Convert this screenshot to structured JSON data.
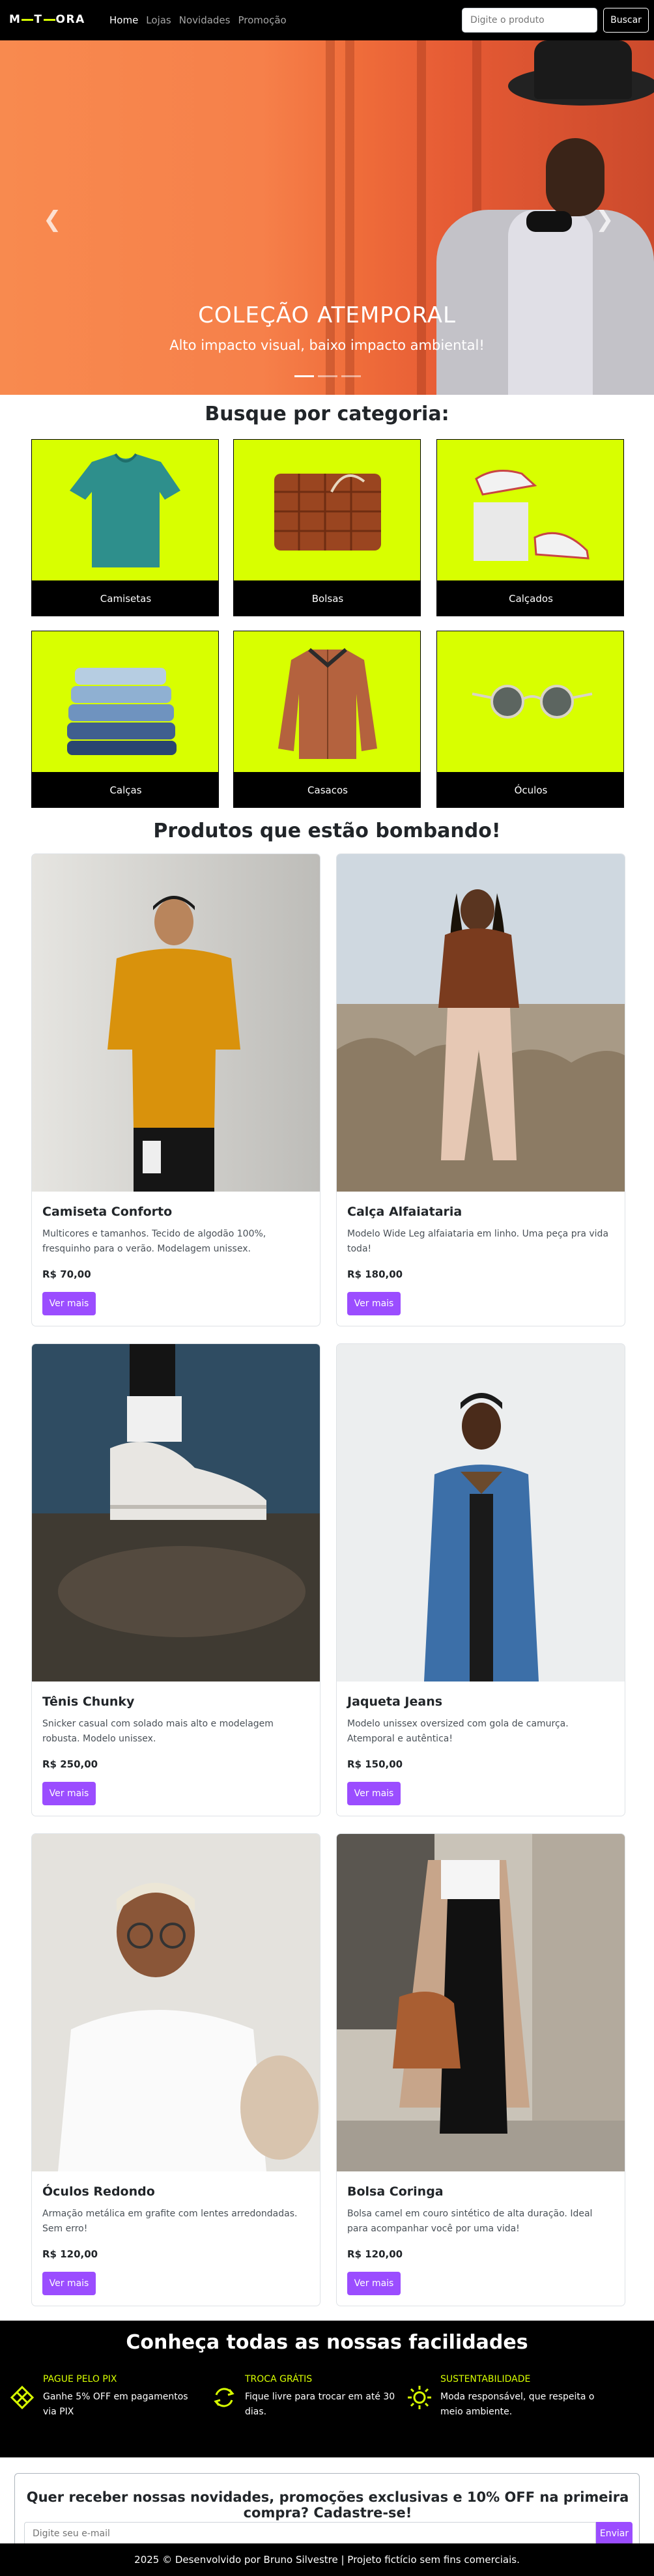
{
  "navbar": {
    "logo": "METEORA",
    "links": [
      "Home",
      "Lojas",
      "Novidades",
      "Promoção"
    ],
    "search_placeholder": "Digite o produto",
    "search_button": "Buscar"
  },
  "hero": {
    "title": "COLEÇÃO ATEMPORAL",
    "subtitle": "Alto impacto visual, baixo impacto ambiental!",
    "prev_icon": "chevron-left-icon",
    "next_icon": "chevron-right-icon",
    "slide_count": 3,
    "active_slide": 1
  },
  "categories": {
    "title": "Busque por categoria:",
    "items": [
      {
        "label": "Camisetas",
        "icon": "tshirt-icon"
      },
      {
        "label": "Bolsas",
        "icon": "bag-icon"
      },
      {
        "label": "Calçados",
        "icon": "sneakers-icon"
      },
      {
        "label": "Calças",
        "icon": "jeans-icon"
      },
      {
        "label": "Casacos",
        "icon": "jacket-icon"
      },
      {
        "label": "Óculos",
        "icon": "sunglasses-icon"
      }
    ]
  },
  "products": {
    "title": "Produtos que estão bombando!",
    "button_label": "Ver mais",
    "items": [
      {
        "name": "Camiseta Conforto",
        "description": "Multicores e tamanhos. Tecido de algodão 100%, fresquinho para o verão. Modelagem unissex.",
        "price": "R$ 70,00"
      },
      {
        "name": "Calça Alfaiataria",
        "description": "Modelo Wide Leg alfaiataria em linho. Uma peça pra vida toda!",
        "price": "R$ 180,00"
      },
      {
        "name": "Tênis Chunky",
        "description": "Snicker casual com solado mais alto e modelagem robusta. Modelo unissex.",
        "price": "R$ 250,00"
      },
      {
        "name": "Jaqueta Jeans",
        "description": "Modelo unissex oversized com gola de camurça. Atemporal e autêntica!",
        "price": "R$ 150,00"
      },
      {
        "name": "Óculos Redondo",
        "description": "Armação metálica em grafite com lentes arredondadas. Sem erro!",
        "price": "R$ 120,00"
      },
      {
        "name": "Bolsa Coringa",
        "description": "Bolsa camel em couro sintético de alta duração. Ideal para acompanhar você por uma vida!",
        "price": "R$ 120,00"
      }
    ]
  },
  "features": {
    "title": "Conheça todas as nossas facilidades",
    "items": [
      {
        "title": "PAGUE PELO PIX",
        "description": "Ganhe 5% OFF em pagamentos via PIX",
        "icon": "pix-icon"
      },
      {
        "title": "TROCA GRÁTIS",
        "description": "Fique livre para trocar em até 30 dias.",
        "icon": "exchange-icon"
      },
      {
        "title": "SUSTENTABILIDADE",
        "description": "Moda responsável, que respeita o meio ambiente.",
        "icon": "sun-icon"
      }
    ]
  },
  "newsletter": {
    "title": "Quer receber nossas novidades, promoções exclusivas e 10% OFF na primeira compra? Cadastre-se!",
    "placeholder": "Digite seu e-mail",
    "button": "Enviar"
  },
  "footer": {
    "text": "2025 © Desenvolvido por Bruno Silvestre | Projeto fictício sem fins comerciais."
  },
  "colors": {
    "accent": "#9b4dff",
    "lime": "#d8ff00",
    "dark": "#000000"
  }
}
